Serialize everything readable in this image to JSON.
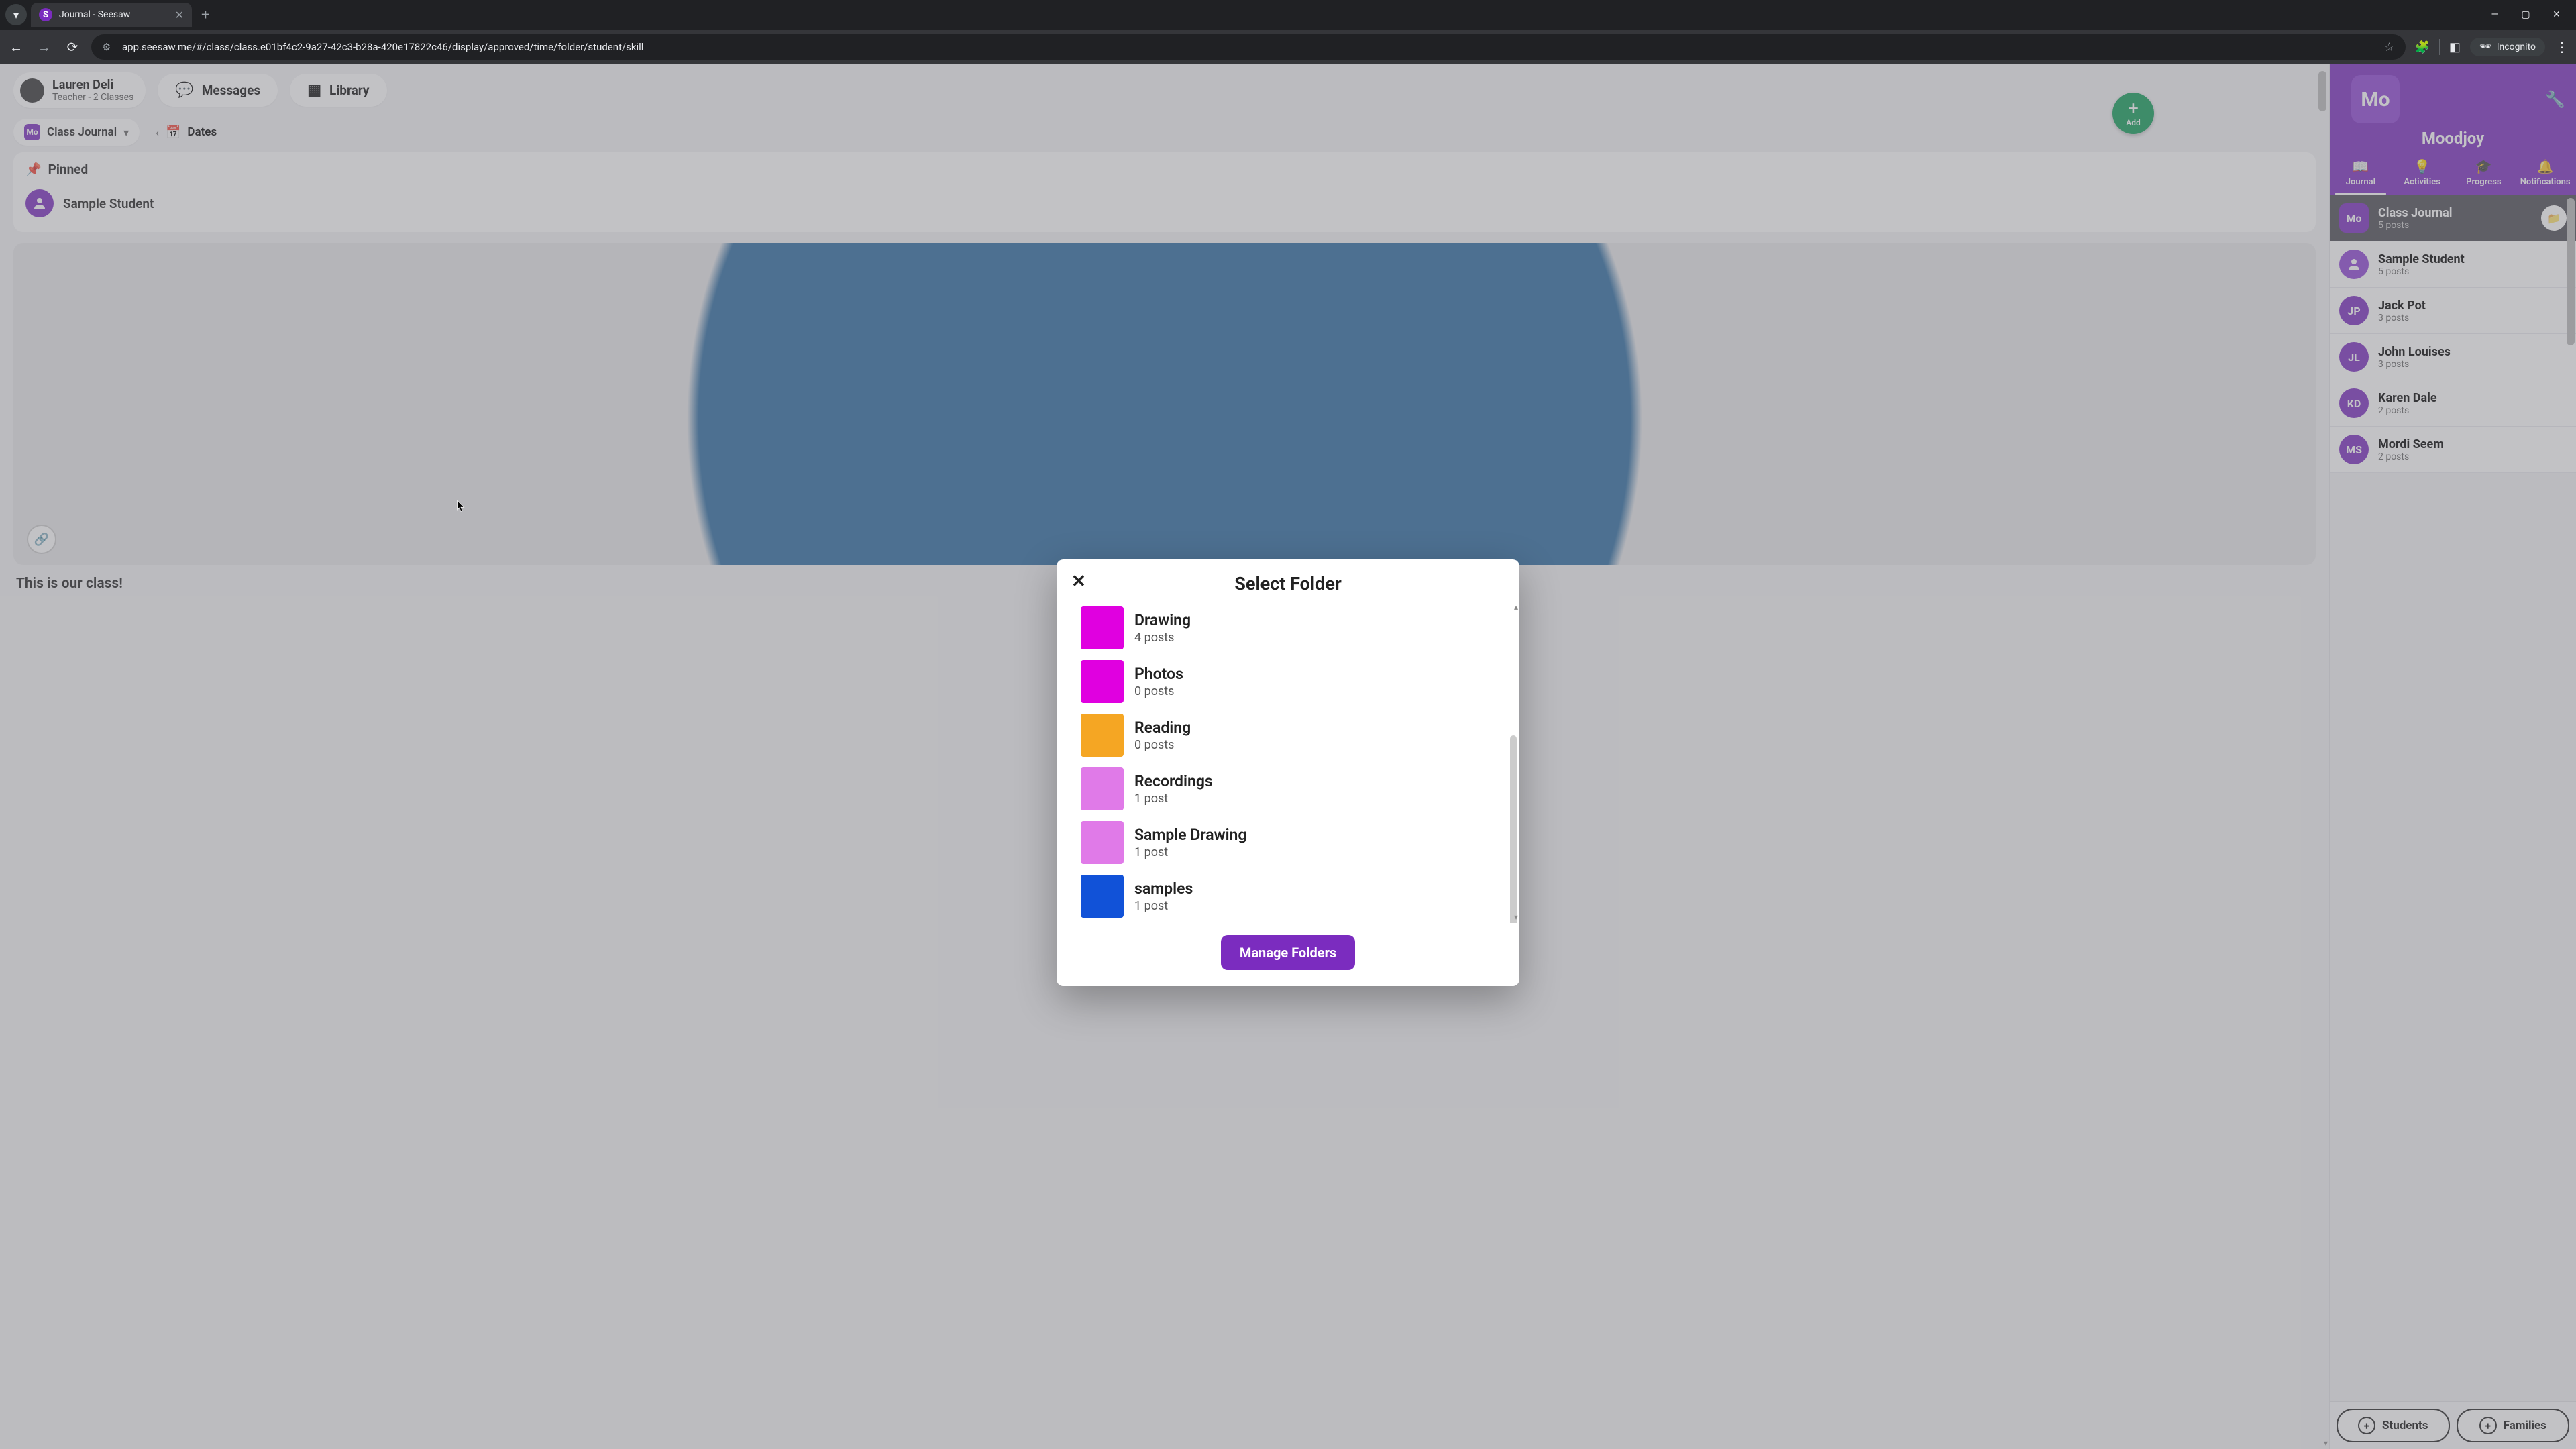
{
  "browser": {
    "tab_title": "Journal - Seesaw",
    "url": "app.seesaw.me/#/class/class.e01bf4c2-9a27-42c3-b28a-420e17822c46/display/approved/time/folder/student/skill",
    "incognito_label": "Incognito"
  },
  "header": {
    "user_name": "Lauren Deli",
    "user_role": "Teacher - 2 Classes",
    "messages_label": "Messages",
    "library_label": "Library"
  },
  "subheader": {
    "journal_square": "Mo",
    "journal_label": "Class Journal",
    "dates_label": "Dates"
  },
  "pinned": {
    "title": "Pinned",
    "student": "Sample Student"
  },
  "post_caption": "This is our class!",
  "right": {
    "class_square": "Mo",
    "class_name": "Moodjoy",
    "add_label": "Add",
    "tabs": {
      "journal": "Journal",
      "activities": "Activities",
      "progress": "Progress",
      "notifications": "Notifications"
    },
    "students": [
      {
        "initials": "Mo",
        "name": "Class Journal",
        "posts": "5 posts",
        "color": "#7b2cbf",
        "square": true,
        "active": true,
        "folder": true
      },
      {
        "initials": "",
        "name": "Sample Student",
        "posts": "5 posts",
        "color": "#8e44d6",
        "square": false,
        "active": false,
        "icon": "person"
      },
      {
        "initials": "JP",
        "name": "Jack Pot",
        "posts": "3 posts",
        "color": "#7b2cbf"
      },
      {
        "initials": "JL",
        "name": "John Louises",
        "posts": "3 posts",
        "color": "#7b2cbf"
      },
      {
        "initials": "KD",
        "name": "Karen Dale",
        "posts": "2 posts",
        "color": "#7b2cbf"
      },
      {
        "initials": "MS",
        "name": "Mordi Seem",
        "posts": "2 posts",
        "color": "#7b2cbf"
      }
    ],
    "students_btn": "Students",
    "families_btn": "Families"
  },
  "modal": {
    "title": "Select Folder",
    "manage_label": "Manage Folders",
    "folders": [
      {
        "name": "Drawing",
        "posts": "4 posts",
        "color": "#e000e0"
      },
      {
        "name": "Photos",
        "posts": "0 posts",
        "color": "#e000e0"
      },
      {
        "name": "Reading",
        "posts": "0 posts",
        "color": "#f5a623"
      },
      {
        "name": "Recordings",
        "posts": "1 post",
        "color": "#e07ae8"
      },
      {
        "name": "Sample Drawing",
        "posts": "1 post",
        "color": "#e07ae8"
      },
      {
        "name": "samples",
        "posts": "1 post",
        "color": "#1152d8"
      }
    ]
  }
}
